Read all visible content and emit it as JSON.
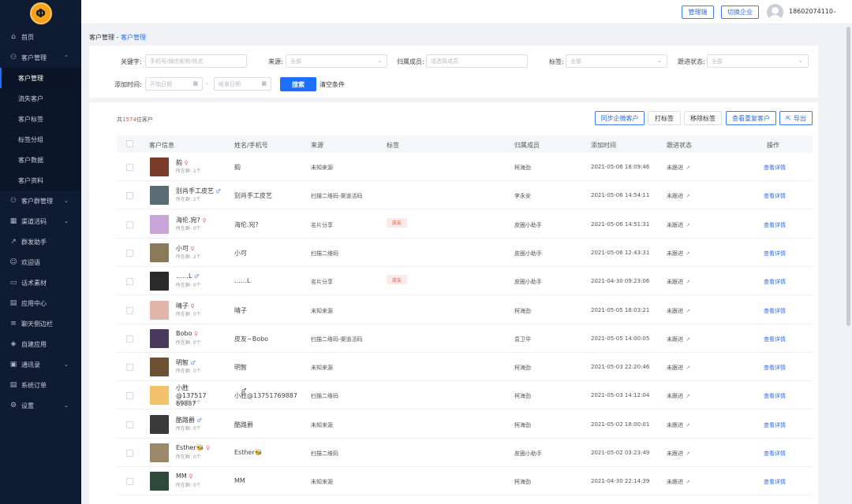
{
  "logo": {
    "text": "Φ"
  },
  "nav": {
    "home": "首页",
    "customer_mgmt": "客户管理",
    "sub": [
      "客户管理",
      "流失客户",
      "客户标签",
      "标签分组",
      "客户数据",
      "客户资料"
    ],
    "items": [
      "客户群管理",
      "渠道活码",
      "群发助手",
      "欢迎语",
      "话术素材",
      "应用中心",
      "聊天侧边栏",
      "自建应用",
      "通讯录",
      "系统订单",
      "设置"
    ]
  },
  "topbar": {
    "admin_btn": "管理端",
    "switch_btn": "切换企业",
    "phone": "18602074110"
  },
  "breadcrumb": {
    "parent": "客户管理",
    "sep": " - ",
    "current": "客户管理"
  },
  "filters": {
    "keyword_label": "关键字:",
    "keyword_placeholder": "手机号/微信昵称/姓名",
    "source_label": "来源:",
    "source_value": "全部",
    "member_label": "归属成员:",
    "member_placeholder": "请选择成员",
    "tag_label": "标签:",
    "tag_value": "全部",
    "status_label": "跟进状态:",
    "status_value": "全部",
    "time_label": "添加时间:",
    "start_placeholder": "开始日期",
    "dash": "-",
    "end_placeholder": "结束日期",
    "search_btn": "搜索",
    "clear": "清空条件"
  },
  "summary": {
    "prefix": "共",
    "count": "1574",
    "suffix": "位客户"
  },
  "actions": {
    "sync": "同步企微客户",
    "tag": "打标签",
    "remove_tag": "移除标签",
    "dup": "查看重复客户",
    "export": "导出"
  },
  "columns": [
    "客户信息",
    "姓名/手机号",
    "来源",
    "标签",
    "归属成员",
    "添加时间",
    "跟进状态",
    "操作"
  ],
  "rows": [
    {
      "nick": "韵",
      "gender": "f",
      "groups": "所在群: 1个",
      "name": "韵",
      "source": "未知来源",
      "tag": "",
      "member": "柯海劲",
      "time": "2021-05-06 18:09:46",
      "status": "未跟进",
      "op": "查看详情",
      "color": "#7a3b2a"
    },
    {
      "nick": "别肖手工皮艺",
      "gender": "m",
      "groups": "所在群: 1个",
      "name": "别肖手工皮艺",
      "source": "扫描二维码-渠道活码",
      "tag": "",
      "member": "李永安",
      "time": "2021-05-06 14:54:11",
      "status": "未跟进",
      "op": "查看详情",
      "color": "#5b6b74"
    },
    {
      "nick": "海伦.宛?",
      "gender": "f",
      "groups": "所在群: 0个",
      "name": "海伦.宛?",
      "source": "名片分享",
      "tag": "皮友",
      "member": "皮圈小助手",
      "time": "2021-05-06 14:51:31",
      "status": "未跟进",
      "op": "查看详情",
      "color": "#c9a6d8"
    },
    {
      "nick": "小可",
      "gender": "f",
      "groups": "所在群: 2个",
      "name": "小可",
      "source": "扫描二维码",
      "tag": "",
      "member": "皮圈小助手",
      "time": "2021-05-06 12:43:31",
      "status": "未跟进",
      "op": "查看详情",
      "color": "#8a7a5a"
    },
    {
      "nick": "……L",
      "gender": "m",
      "groups": "所在群: 0个",
      "name": "……L",
      "source": "名片分享",
      "tag": "皮友",
      "member": "皮圈小助手",
      "time": "2021-04-30 09:23:06",
      "status": "未跟进",
      "op": "查看详情",
      "color": "#2a2a2a"
    },
    {
      "nick": "晴子",
      "gender": "f",
      "groups": "所在群: 0个",
      "name": "晴子",
      "source": "未知来源",
      "tag": "",
      "member": "柯海劲",
      "time": "2021-05-05 18:03:21",
      "status": "未跟进",
      "op": "查看详情",
      "color": "#e0b6a8"
    },
    {
      "nick": "Bobo",
      "gender": "f",
      "groups": "所在群: 0个",
      "name": "皮友~Bobo",
      "source": "扫描二维码-渠道活码",
      "tag": "",
      "member": "袁卫华",
      "time": "2021-05-05 14:00:05",
      "status": "未跟进",
      "op": "查看详情",
      "color": "#4a3a5e"
    },
    {
      "nick": "明智",
      "gender": "m",
      "groups": "所在群: 0个",
      "name": "明智",
      "source": "未知来源",
      "tag": "",
      "member": "柯海劲",
      "time": "2021-05-03 22:20:46",
      "status": "未跟进",
      "op": "查看详情",
      "color": "#6b5034"
    },
    {
      "nick": "小胜@137517 69887",
      "gender": "m",
      "groups": "所在群: 0个",
      "name": "小胜@13751769887",
      "source": "扫描二维码",
      "tag": "",
      "member": "柯海劲",
      "time": "2021-05-03 14:12:04",
      "status": "未跟进",
      "op": "查看详情",
      "color": "#f2c26a"
    },
    {
      "nick": "酷路爵",
      "gender": "m",
      "groups": "所在群: 0个",
      "name": "酷路爵",
      "source": "未知来源",
      "tag": "",
      "member": "柯海劲",
      "time": "2021-05-02 18:00:01",
      "status": "未跟进",
      "op": "查看详情",
      "color": "#3a3a3a"
    },
    {
      "nick": "Esther🐝",
      "gender": "f",
      "groups": "所在群: 0个",
      "name": "Esther🐝",
      "source": "扫描二维码",
      "tag": "",
      "member": "皮圈小助手",
      "time": "2021-05-02 03:23:49",
      "status": "未跟进",
      "op": "查看详情",
      "color": "#9a8a6a"
    },
    {
      "nick": "MM",
      "gender": "f",
      "groups": "所在群: 0个",
      "name": "MM",
      "source": "未知来源",
      "tag": "",
      "member": "柯海劲",
      "time": "2021-04-30 22:14:39",
      "status": "未跟进",
      "op": "查看详情",
      "color": "#2f4a3a"
    }
  ]
}
